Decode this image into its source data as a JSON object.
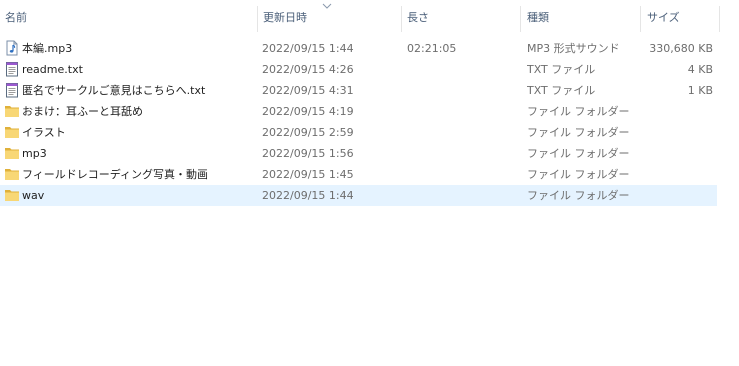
{
  "columns": {
    "name": "名前",
    "date_modified": "更新日時",
    "length": "長さ",
    "type": "種類",
    "size": "サイズ"
  },
  "files": [
    {
      "name": "本編.mp3",
      "date": "2022/09/15 1:44",
      "length": "02:21:05",
      "type": "MP3 形式サウンド",
      "size": "330,680 KB",
      "icon": "music-file-icon"
    },
    {
      "name": "readme.txt",
      "date": "2022/09/15 4:26",
      "length": "",
      "type": "TXT ファイル",
      "size": "4 KB",
      "icon": "text-file-icon"
    },
    {
      "name": "匿名でサークルご意見はこちらへ.txt",
      "date": "2022/09/15 4:31",
      "length": "",
      "type": "TXT ファイル",
      "size": "1 KB",
      "icon": "text-file-icon"
    },
    {
      "name": "おまけ：耳ふーと耳舐め",
      "date": "2022/09/15 4:19",
      "length": "",
      "type": "ファイル フォルダー",
      "size": "",
      "icon": "folder-icon"
    },
    {
      "name": "イラスト",
      "date": "2022/09/15 2:59",
      "length": "",
      "type": "ファイル フォルダー",
      "size": "",
      "icon": "folder-icon"
    },
    {
      "name": "mp3",
      "date": "2022/09/15 1:56",
      "length": "",
      "type": "ファイル フォルダー",
      "size": "",
      "icon": "folder-icon"
    },
    {
      "name": "フィールドレコーディング写真・動画",
      "date": "2022/09/15 1:45",
      "length": "",
      "type": "ファイル フォルダー",
      "size": "",
      "icon": "folder-icon"
    },
    {
      "name": "wav",
      "date": "2022/09/15 1:44",
      "length": "",
      "type": "ファイル フォルダー",
      "size": "",
      "icon": "folder-icon",
      "selected": true
    }
  ],
  "colors": {
    "header_text": "#4c607a",
    "selection": "#e5f3ff",
    "folder_fill": "#f8d775",
    "folder_edge": "#e0b13a"
  }
}
